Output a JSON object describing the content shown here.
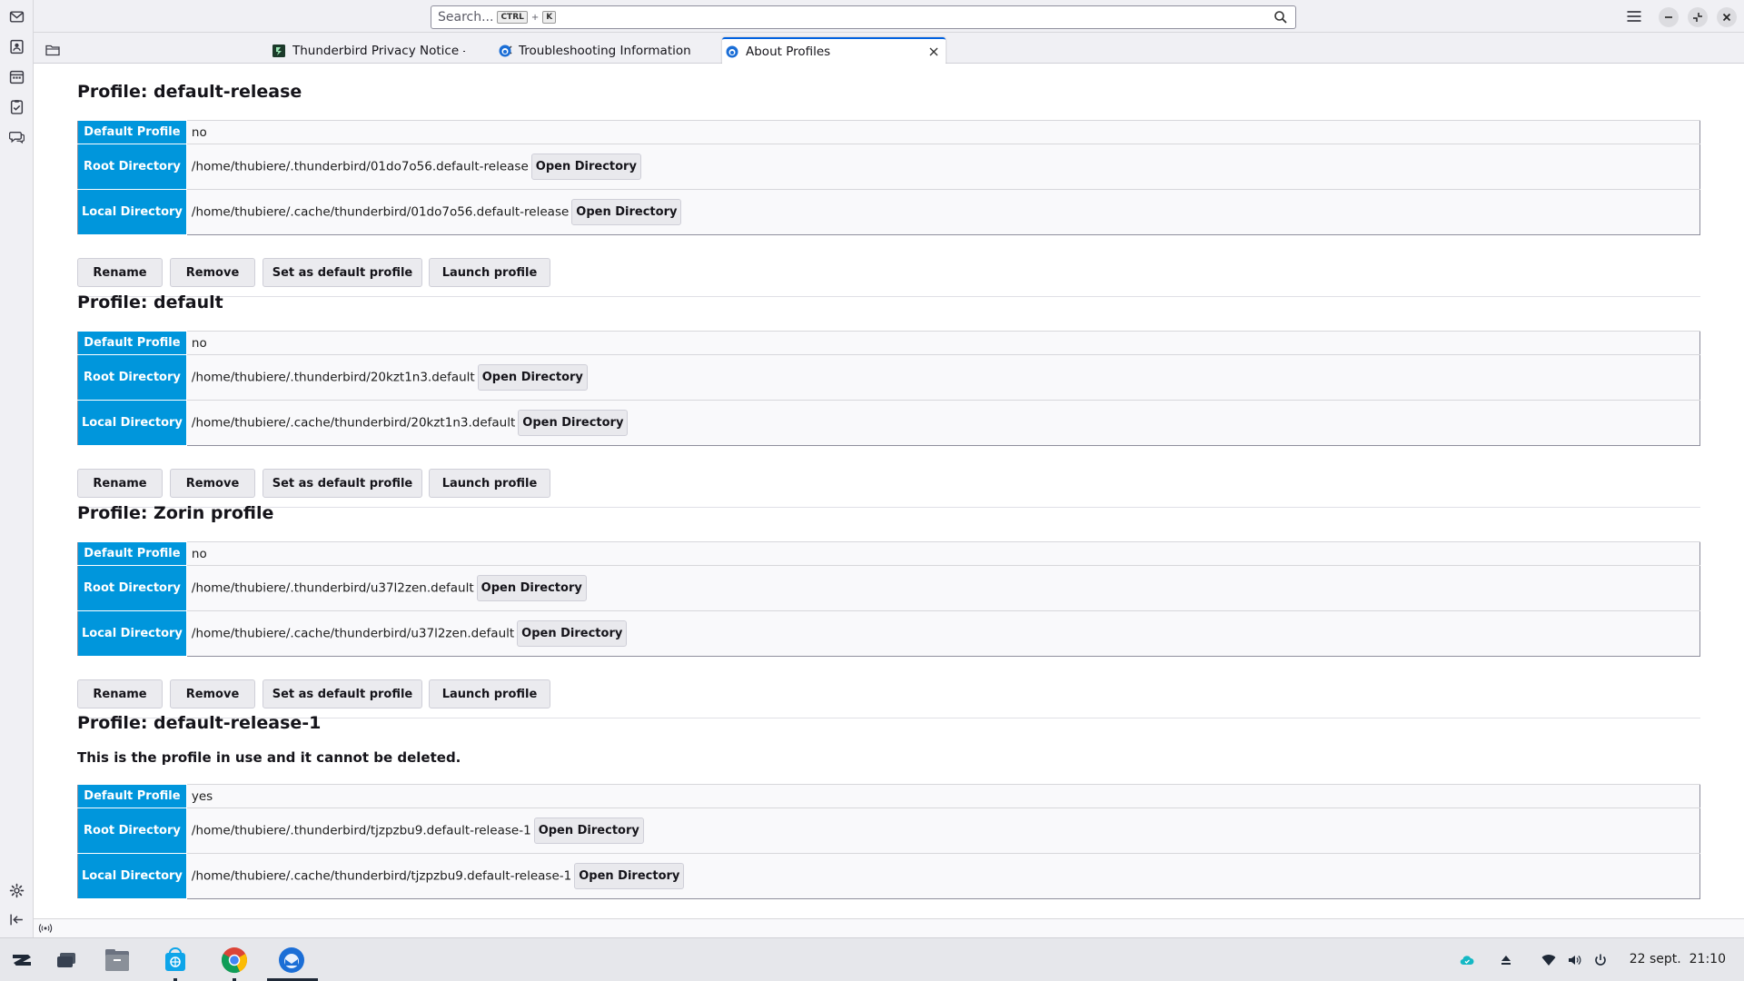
{
  "search": {
    "placeholder": "Search...",
    "key1": "CTRL",
    "plus": "+",
    "key2": "K"
  },
  "tabs": [
    {
      "label": "Thunderbird Privacy Notice —"
    },
    {
      "label": "Troubleshooting Information"
    },
    {
      "label": "About Profiles"
    }
  ],
  "labels": {
    "default_profile": "Default Profile",
    "root_directory": "Root Directory",
    "local_directory": "Local Directory",
    "open_directory": "Open Directory",
    "rename": "Rename",
    "remove": "Remove",
    "set_default": "Set as default profile",
    "launch": "Launch profile"
  },
  "profiles": [
    {
      "title": "Profile: default-release",
      "default": "no",
      "root": "/home/thubiere/.thunderbird/01do7o56.default-release",
      "local": "/home/thubiere/.cache/thunderbird/01do7o56.default-release"
    },
    {
      "title": "Profile: default",
      "default": "no",
      "root": "/home/thubiere/.thunderbird/20kzt1n3.default",
      "local": "/home/thubiere/.cache/thunderbird/20kzt1n3.default"
    },
    {
      "title": "Profile: Zorin profile",
      "default": "no",
      "root": "/home/thubiere/.thunderbird/u37l2zen.default",
      "local": "/home/thubiere/.cache/thunderbird/u37l2zen.default"
    },
    {
      "title": "Profile: default-release-1",
      "note": "This is the profile in use and it cannot be deleted.",
      "default": "yes",
      "root": "/home/thubiere/.thunderbird/tjzpzbu9.default-release-1",
      "local": "/home/thubiere/.cache/thunderbird/tjzpzbu9.default-release-1"
    }
  ],
  "clock": {
    "date": "22 sept.",
    "time": "21:10"
  },
  "colors": {
    "accent": "#0096dc",
    "tab_highlight": "#0061e0"
  }
}
